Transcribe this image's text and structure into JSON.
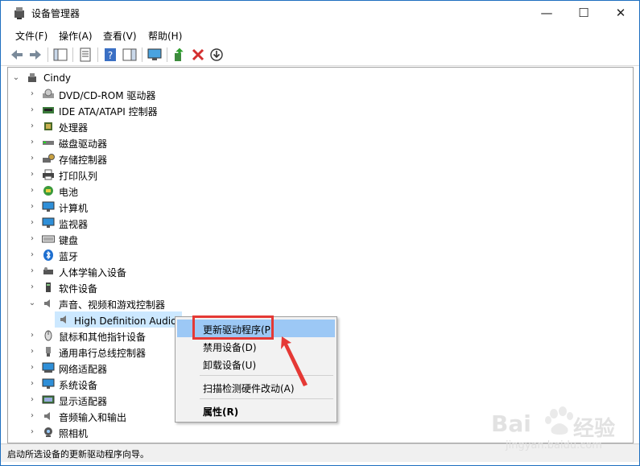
{
  "window": {
    "title": "设备管理器"
  },
  "menu": [
    "文件(F)",
    "操作(A)",
    "查看(V)",
    "帮助(H)"
  ],
  "tree": {
    "root": "Cindy",
    "items": [
      "DVD/CD-ROM 驱动器",
      "IDE ATA/ATAPI 控制器",
      "处理器",
      "磁盘驱动器",
      "存储控制器",
      "打印队列",
      "电池",
      "计算机",
      "监视器",
      "键盘",
      "蓝牙",
      "人体学输入设备",
      "软件设备",
      "声音、视频和游戏控制器",
      "High Definition Audio 设备",
      "鼠标和其他指针设备",
      "通用串行总线控制器",
      "网络适配器",
      "系统设备",
      "显示适配器",
      "音频输入和输出",
      "照相机"
    ]
  },
  "context_menu": {
    "update_driver": "更新驱动程序(P)",
    "disable": "禁用设备(D)",
    "uninstall": "卸载设备(U)",
    "scan": "扫描检测硬件改动(A)",
    "properties": "属性(R)"
  },
  "status": "启动所选设备的更新驱动程序向导。",
  "watermark": {
    "brand": "Bai",
    "brand2": "经验",
    "url": "jingyan.baidu.com"
  },
  "colors": {
    "accent": "#0078d7",
    "selection": "#cce8ff",
    "annotation": "#e53935"
  }
}
